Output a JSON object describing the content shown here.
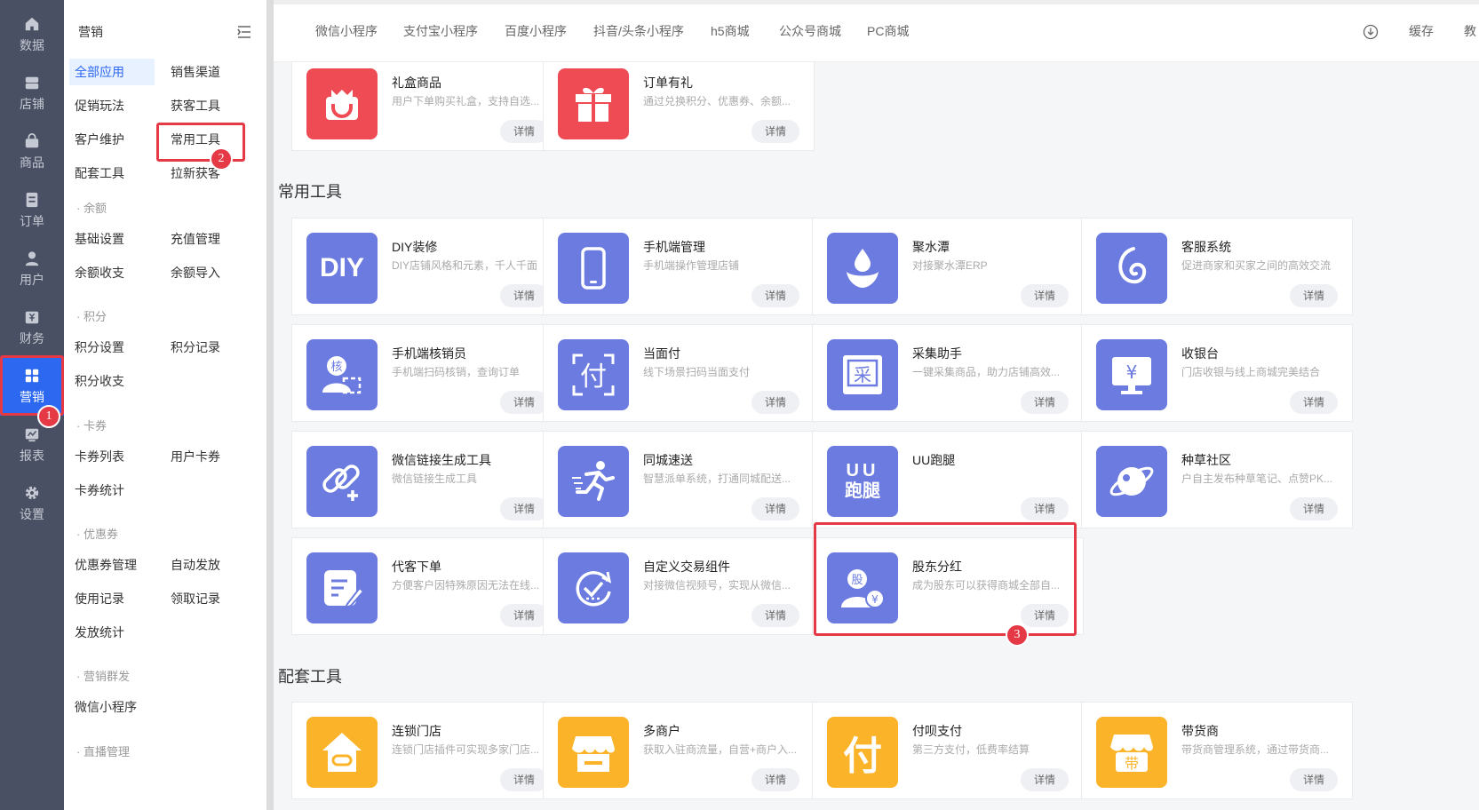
{
  "nav": {
    "items": [
      {
        "label": "数据",
        "icon": "home-icon"
      },
      {
        "label": "店铺",
        "icon": "store-icon"
      },
      {
        "label": "商品",
        "icon": "bag-icon"
      },
      {
        "label": "订单",
        "icon": "document-icon"
      },
      {
        "label": "用户",
        "icon": "user-icon"
      },
      {
        "label": "财务",
        "icon": "finance-icon"
      },
      {
        "label": "营销",
        "icon": "apps-grid-icon"
      },
      {
        "label": "报表",
        "icon": "chart-icon"
      },
      {
        "label": "设置",
        "icon": "gear-icon"
      }
    ],
    "active_index": 6
  },
  "submenu": {
    "title": "营销",
    "items": {
      "all_apps": "全部应用",
      "sales_channel": "销售渠道",
      "promotion": "促销玩法",
      "acquire_tools": "获客工具",
      "customer_care": "客户维护",
      "common_tools": "常用工具",
      "support_tools": "配套工具",
      "pull_new": "拉新获客",
      "basic_settings": "基础设置",
      "recharge_mgmt": "充值管理",
      "balance_flow": "余额收支",
      "balance_import": "余额导入",
      "points_settings": "积分设置",
      "points_records": "积分记录",
      "points_flow": "积分收支",
      "card_list": "卡券列表",
      "user_cards": "用户卡券",
      "card_stats": "卡券统计",
      "coupon_mgmt": "优惠券管理",
      "auto_issue": "自动发放",
      "usage_records": "使用记录",
      "claim_records": "领取记录",
      "issue_stats": "发放统计",
      "wechat_miniapp": "微信小程序"
    },
    "groups": {
      "balance": "· 余额",
      "points": "· 积分",
      "cards": "· 卡券",
      "coupons": "· 优惠券",
      "group_marketing": "· 营销群发",
      "live": "· 直播管理"
    }
  },
  "topbar": {
    "tabs": [
      "微信小程序",
      "支付宝小程序",
      "百度小程序",
      "抖音/头条小程序",
      "h5商城",
      "公众号商城",
      "PC商城"
    ],
    "cache": "缓存",
    "tutorial": "教"
  },
  "detail_label": "详情",
  "sections": {
    "common_tools": "常用工具",
    "support_tools": "配套工具"
  },
  "cards": {
    "gift_box": {
      "name": "礼盒商品",
      "desc": "用户下单购买礼盒，支持自选...",
      "color": "#ef4b55"
    },
    "order_gift": {
      "name": "订单有礼",
      "desc": "通过兑换积分、优惠券、余额...",
      "color": "#ef4b55"
    },
    "diy": {
      "name": "DIY装修",
      "desc": "DIY店铺风格和元素，千人千面",
      "color": "#6b7be0",
      "icon_text": "DIY"
    },
    "mobile_mgmt": {
      "name": "手机端管理",
      "desc": "手机端操作管理店铺",
      "color": "#6b7be0"
    },
    "jushuitan": {
      "name": "聚水潭",
      "desc": "对接聚水潭ERP",
      "color": "#6b7be0"
    },
    "service": {
      "name": "客服系统",
      "desc": "促进商家和买家之间的高效交流",
      "color": "#6b7be0"
    },
    "verifier": {
      "name": "手机端核销员",
      "desc": "手机端扫码核销，查询订单",
      "color": "#6b7be0",
      "icon_text": "核"
    },
    "face_pay": {
      "name": "当面付",
      "desc": "线下场景扫码当面支付",
      "color": "#6b7be0",
      "icon_text": "付"
    },
    "collector": {
      "name": "采集助手",
      "desc": "一键采集商品，助力店铺高效...",
      "color": "#6b7be0",
      "icon_text": "采"
    },
    "cashier": {
      "name": "收银台",
      "desc": "门店收银与线上商城完美结合",
      "color": "#6b7be0",
      "icon_text": "¥"
    },
    "wx_link": {
      "name": "微信链接生成工具",
      "desc": "微信链接生成工具",
      "color": "#6b7be0"
    },
    "city_delivery": {
      "name": "同城速送",
      "desc": "智慧派单系统，打通同城配送...",
      "color": "#6b7be0"
    },
    "uu_runner": {
      "name": "UU跑腿",
      "desc": "",
      "color": "#6b7be0",
      "icon_text_top": "UU",
      "icon_text_bottom": "跑腿"
    },
    "community": {
      "name": "种草社区",
      "desc": "户自主发布种草笔记、点赞PK...",
      "color": "#6b7be0"
    },
    "proxy_order": {
      "name": "代客下单",
      "desc": "方便客户因特殊原因无法在线...",
      "color": "#6b7be0"
    },
    "custom_trade": {
      "name": "自定义交易组件",
      "desc": "对接微信视频号，实现从微信...",
      "color": "#6b7be0"
    },
    "dividend": {
      "name": "股东分红",
      "desc": "成为股东可以获得商城全部自...",
      "color": "#6b7be0",
      "icon_text": "股"
    },
    "chain_store": {
      "name": "连锁门店",
      "desc": "连锁门店插件可实现多家门店...",
      "color": "#fbb32a"
    },
    "multi_merchant": {
      "name": "多商户",
      "desc": "获取入驻商流量，自营+商户入...",
      "color": "#fbb32a"
    },
    "fubei": {
      "name": "付呗支付",
      "desc": "第三方支付，低费率结算",
      "color": "#fbb32a",
      "icon_text": "付"
    },
    "distributor": {
      "name": "带货商",
      "desc": "带货商管理系统，通过带货商...",
      "color": "#fbb32a",
      "icon_text": "带"
    }
  },
  "annotations": [
    "1",
    "2",
    "3"
  ]
}
